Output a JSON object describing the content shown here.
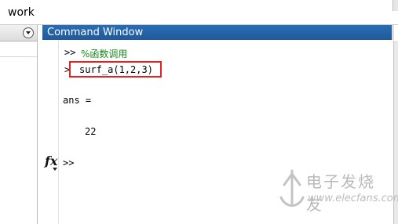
{
  "top_panel": {
    "title": "work"
  },
  "command_window": {
    "title": "Command Window",
    "lines": {
      "comment_prompt": ">>",
      "comment_text": "%函数调用",
      "call_prompt": ">",
      "call_text": "surf_a(1,2,3)",
      "ans_label": "ans =",
      "ans_value": "22",
      "final_prompt": ">>"
    },
    "fx_icon": "fx-icon"
  },
  "colors": {
    "header_bg": "#1f5a9c",
    "comment_green": "#1a8a1a",
    "highlight_red": "#e02424"
  },
  "watermark": {
    "cn": "电子发烧友",
    "en": "www.elecfans.com"
  }
}
